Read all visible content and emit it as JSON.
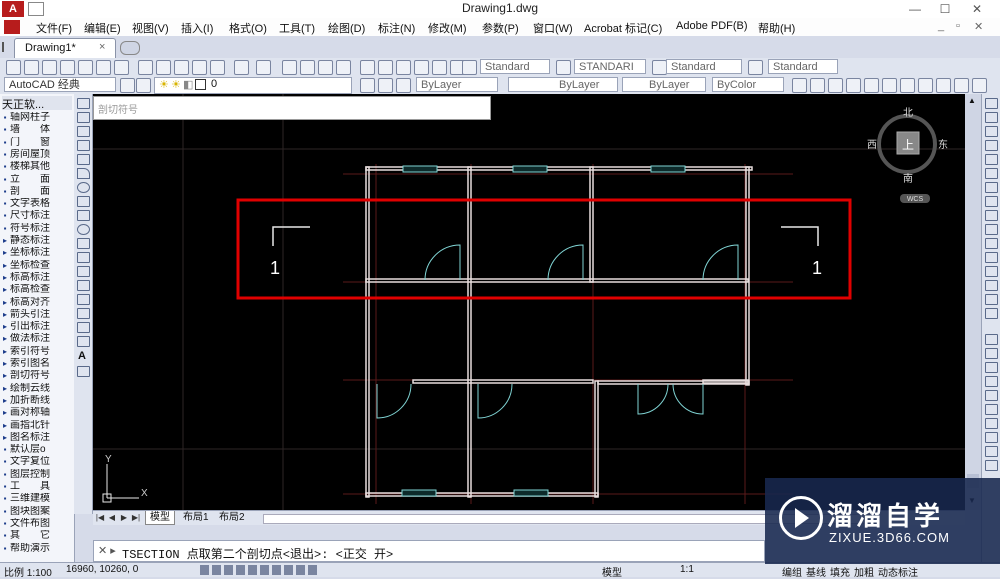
{
  "window": {
    "title": "Drawing1.dwg",
    "logo_letter": "A"
  },
  "menu": [
    "文件(F)",
    "编辑(E)",
    "视图(V)",
    "插入(I)",
    "格式(O)",
    "工具(T)",
    "绘图(D)",
    "标注(N)",
    "修改(M)",
    "参数(P)",
    "窗口(W)",
    "Acrobat 标记(C)",
    "Adobe PDF(B)",
    "帮助(H)"
  ],
  "doc_tab": {
    "label": "Drawing1*",
    "close": "×"
  },
  "toolbar": {
    "text_style": "Standard",
    "dim_style": "STANDARI",
    "table_style": "Standard",
    "multileader_style": "Standard",
    "workspace": "AutoCAD 经典",
    "layer": "0",
    "color": "ByLayer",
    "linetype": "ByLayer",
    "lineweight": "ByLayer",
    "plot_style": "ByColor"
  },
  "left_panel": {
    "title": "天正软...",
    "items": [
      "轴网柱子",
      "墙　　体",
      "门　　窗",
      "房间屋顶",
      "楼梯其他",
      "立　　面",
      "剖　　面",
      "文字表格",
      "尺寸标注",
      "符号标注",
      "静态标注",
      "坐标标注",
      "坐标检查",
      "标高标注",
      "标高检查",
      "标高对齐",
      "箭头引注",
      "引出标注",
      "做法标注",
      "索引符号",
      "索引图名",
      "剖切符号",
      "绘制云线",
      "加折断线",
      "画对称轴",
      "画指北针",
      "图名标注",
      "默认层o",
      "文字复位",
      "图层控制",
      "工　　具",
      "三维建模",
      "图块图案",
      "文件布图",
      "其　　它",
      "帮助演示"
    ]
  },
  "command_hint": "剖切符号",
  "compass": {
    "north": "北",
    "south": "南",
    "east": "东",
    "west": "西",
    "top": "上",
    "ucs": "WCS"
  },
  "drawing": {
    "section_label_left": "1",
    "section_label_right": "1",
    "ucs_x": "X",
    "ucs_y": "Y"
  },
  "layout_tabs": [
    "模型",
    "布局1",
    "布局2"
  ],
  "command_line": {
    "prefix": "✕ ▸",
    "text": "TSECTION 点取第二个剖切点<退出>: <正交 开>"
  },
  "status_bar": {
    "scale": "比例 1:100",
    "coordinates": "16960, 10260, 0",
    "model": "模型",
    "annotation_scale": "1:1",
    "right_items": [
      "编组",
      "基线",
      "填充",
      "加粗",
      "动态标注"
    ]
  },
  "watermark": {
    "title": "溜溜自学",
    "subtitle": "ZIXUE.3D66.COM"
  },
  "colors": {
    "canvas": "#000000",
    "highlight": "#e00000",
    "wall": "#e8dede",
    "door": "#7fd3d3",
    "grid": "#3a2a2a"
  }
}
